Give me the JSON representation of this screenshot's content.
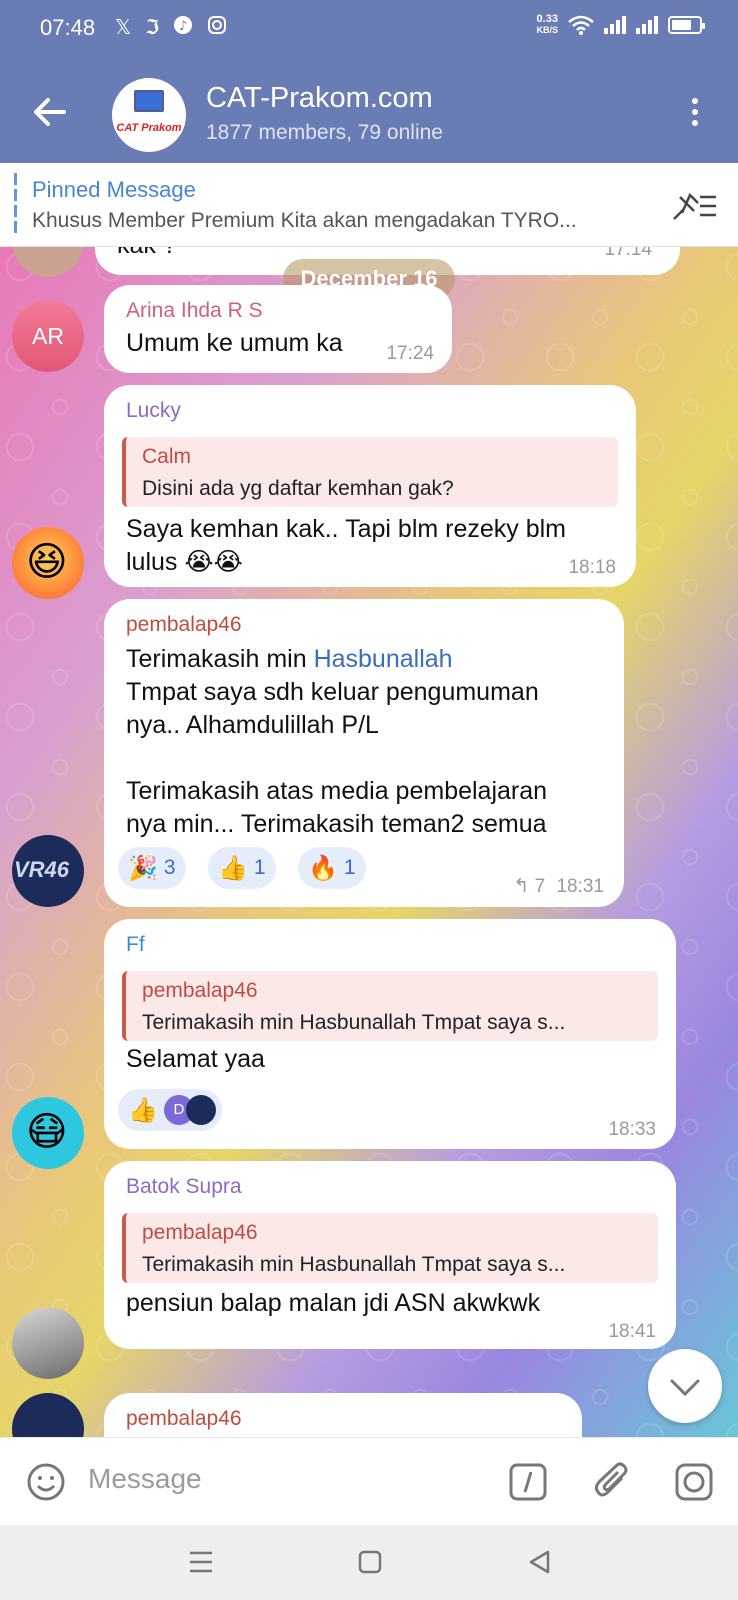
{
  "status_bar": {
    "time": "07:48",
    "net_speed": "0.33",
    "net_unit": "KB/S",
    "app_icons": [
      "x-icon",
      "threads-icon",
      "tiktok-icon",
      "instagram-icon"
    ]
  },
  "header": {
    "title": "CAT-Prakom.com",
    "subtitle": "1877 members, 79 online",
    "avatar_text": "CAT Prakom"
  },
  "pinned": {
    "label": "Pinned Message",
    "text": "Khusus Member Premium Kita akan mengadakan TYRO..."
  },
  "chat": {
    "date_divider": "December 16",
    "top_fragment": {
      "text": "kak ?",
      "time": "17:14"
    },
    "messages": [
      {
        "sender": "Arina Ihda R S",
        "sender_color": "#d1607e",
        "avatar_initials": "AR",
        "text": "Umum ke umum ka",
        "time": "17:24"
      },
      {
        "sender": "Lucky",
        "sender_color": "#8a6cc4",
        "reply_to": {
          "name": "Calm",
          "text": "Disini ada yg daftar kemhan gak?"
        },
        "text_line1": "Saya kemhan kak.. Tapi blm rezeky blm",
        "text_line2": "lulus 😭😭",
        "time": "18:18"
      },
      {
        "sender": "pembalap46",
        "sender_color": "#c24b41",
        "text_line1_prefix": "Terimakasih min ",
        "text_line1_mention": "Hasbunallah",
        "text_line2": "Tmpat saya sdh keluar pengumuman",
        "text_line3": "nya.. Alhamdulillah P/L",
        "text_line4": "Terimakasih atas media pembelajaran",
        "text_line5": "nya min... Terimakasih teman2 semua",
        "reactions": [
          {
            "emoji": "🎉",
            "count": "3"
          },
          {
            "emoji": "👍",
            "count": "1"
          },
          {
            "emoji": "🔥",
            "count": "1"
          }
        ],
        "replies_count": "7",
        "time": "18:31",
        "avatar_text": "VR46"
      },
      {
        "sender": "Ff",
        "sender_color": "#3a8fc9",
        "reply_to": {
          "name": "pembalap46",
          "text": "Terimakasih min Hasbunallah  Tmpat saya s..."
        },
        "text": "Selamat yaa",
        "reaction_emoji": "👍",
        "reaction_avatar": "D",
        "time": "18:33"
      },
      {
        "sender": "Batok Supra",
        "sender_color": "#8a6cc4",
        "reply_to": {
          "name": "pembalap46",
          "text": "Terimakasih min Hasbunallah  Tmpat saya s..."
        },
        "text": "pensiun balap malan jdi ASN akwkwk",
        "time": "18:41"
      },
      {
        "sender": "pembalap46",
        "sender_color": "#c24b41"
      }
    ]
  },
  "input": {
    "placeholder": "Message"
  },
  "colors": {
    "header_bg": "#6a7cb4",
    "link": "#3a6cc4",
    "reaction_bg": "#e5ecfa"
  }
}
